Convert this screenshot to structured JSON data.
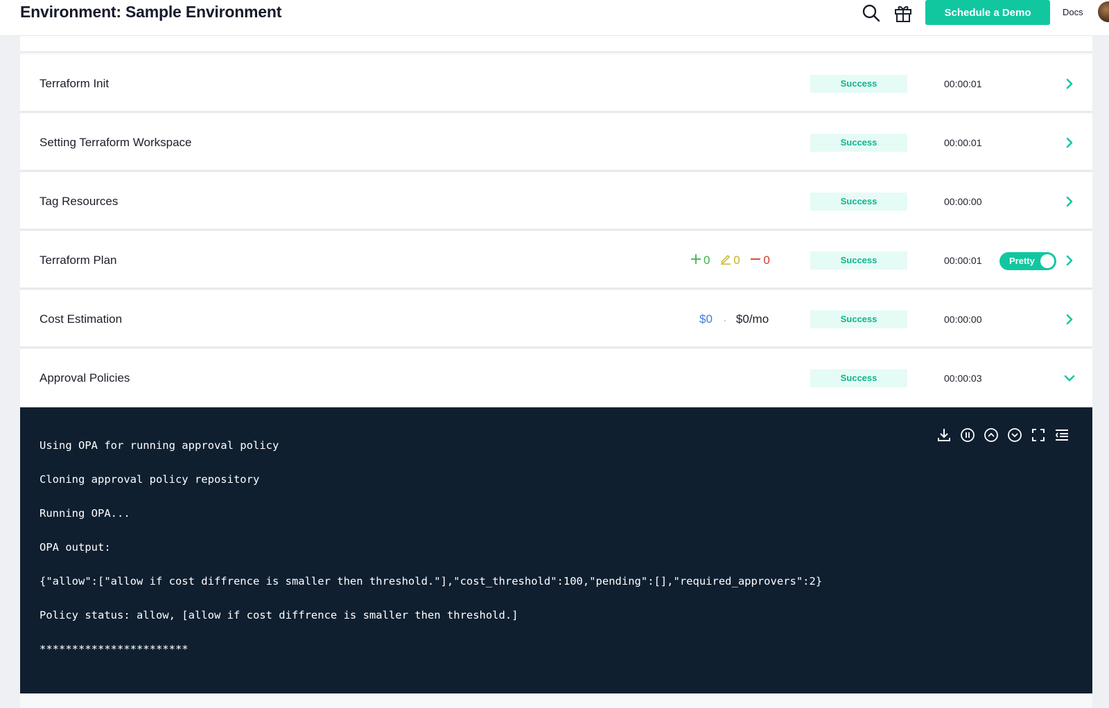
{
  "header": {
    "title": "Environment: Sample Environment",
    "demo_button": "Schedule a Demo",
    "docs_link": "Docs"
  },
  "steps": [
    {
      "name": "Terraform Init",
      "status": "Success",
      "duration": "00:00:01"
    },
    {
      "name": "Setting Terraform Workspace",
      "status": "Success",
      "duration": "00:00:01"
    },
    {
      "name": "Tag Resources",
      "status": "Success",
      "duration": "00:00:00"
    },
    {
      "name": "Terraform Plan",
      "status": "Success",
      "duration": "00:00:01",
      "added": "0",
      "changed": "0",
      "destroyed": "0",
      "toggle_label": "Pretty"
    },
    {
      "name": "Cost Estimation",
      "status": "Success",
      "duration": "00:00:00",
      "cost_current": "$0",
      "cost_monthly": "$0/mo"
    },
    {
      "name": "Approval Policies",
      "status": "Success",
      "duration": "00:00:03"
    }
  ],
  "log": {
    "lines": [
      "Using OPA for running approval policy",
      "Cloning approval policy repository",
      "Running OPA...",
      "OPA output:",
      "{\"allow\":[\"allow if cost diffrence is smaller then threshold.\"],\"cost_threshold\":100,\"pending\":[],\"required_approvers\":2}",
      "Policy status: allow, [allow if cost diffrence is smaller then threshold.]",
      "***********************"
    ]
  },
  "colors": {
    "accent": "#11c7a0",
    "success_bg": "#e5fbf5",
    "success_text": "#10b48e",
    "console_bg": "#0f1f30"
  }
}
